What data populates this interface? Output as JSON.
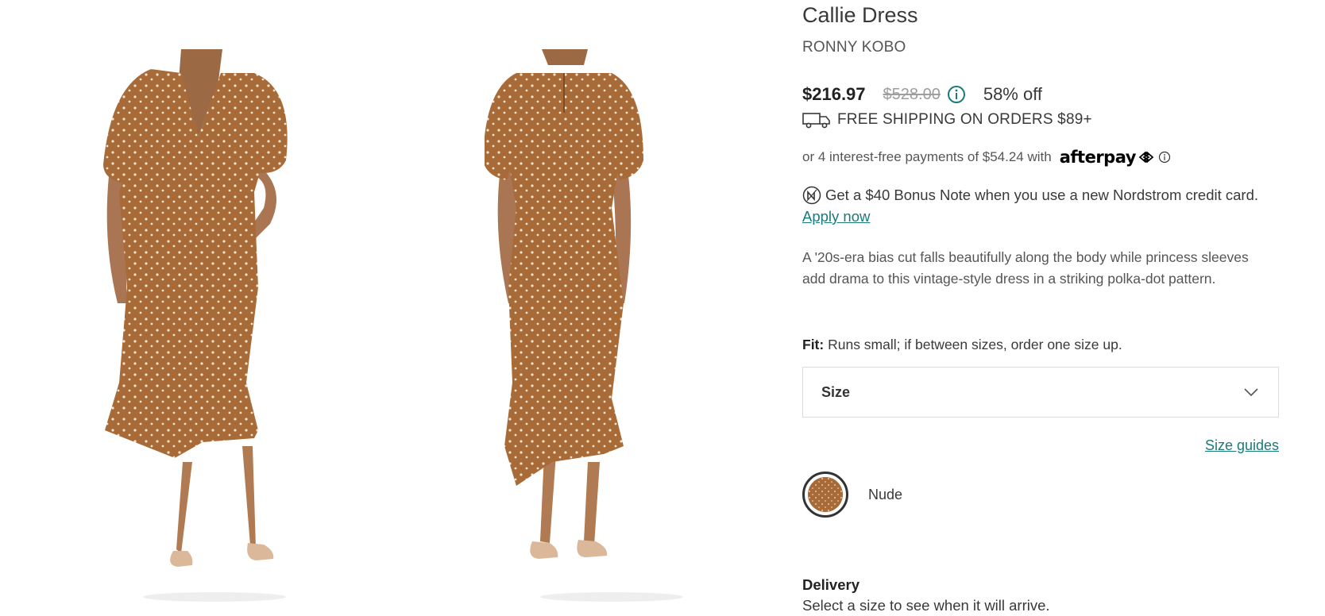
{
  "product": {
    "title": "Callie Dress",
    "brand": "RONNY KOBO",
    "price": "$216.97",
    "original_price": "$528.00",
    "discount": "58% off",
    "shipping": "FREE SHIPPING ON ORDERS $89+",
    "installments": "or 4 interest-free payments of $54.24 with",
    "afterpay_logo": "afterpay",
    "bonus_note": "Get a $40 Bonus Note when you use a new Nordstrom credit card.",
    "apply_link": "Apply now",
    "description": "A '20s-era bias cut falls beautifully along the body while princess sleeves add drama to this vintage-style dress in a striking polka-dot pattern.",
    "fit_label": "Fit:",
    "fit_text": "Runs small; if between sizes, order one size up.",
    "size_select_label": "Size",
    "size_guides": "Size guides",
    "color_name": "Nude",
    "delivery_heading": "Delivery",
    "delivery_text": "Select a size to see when it will arrive."
  },
  "icons": {
    "price_info": "info-circle-icon",
    "shipping": "truck-icon",
    "afterpay_arrows": "afterpay-arrows-icon",
    "afterpay_info": "info-circle-icon",
    "nordstrom": "nordstrom-note-icon",
    "size_dropdown": "chevron-down-icon"
  },
  "colors": {
    "accent_link": "#1a7a7a",
    "dress": "#a86a36",
    "text": "#393939",
    "strikethrough": "#9e9e9e"
  },
  "gallery": {
    "images": [
      "front-view",
      "back-view"
    ]
  }
}
